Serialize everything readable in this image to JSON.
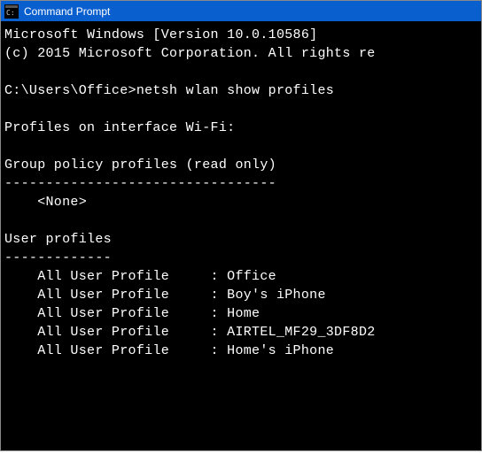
{
  "titlebar": {
    "title": "Command Prompt"
  },
  "console": {
    "banner_line1": "Microsoft Windows [Version 10.0.10586]",
    "banner_line2": "(c) 2015 Microsoft Corporation. All rights re",
    "prompt": "C:\\Users\\Office>",
    "command": "netsh wlan show profiles",
    "interface_line": "Profiles on interface Wi-Fi:",
    "group_header": "Group policy profiles (read only)",
    "group_dashes": "---------------------------------",
    "group_none": "    <None>",
    "user_header": "User profiles",
    "user_dashes": "-------------",
    "profiles": [
      {
        "label": "    All User Profile     : ",
        "name": "Office"
      },
      {
        "label": "    All User Profile     : ",
        "name": "Boy's iPhone"
      },
      {
        "label": "    All User Profile     : ",
        "name": "Home"
      },
      {
        "label": "    All User Profile     : ",
        "name": "AIRTEL_MF29_3DF8D2"
      },
      {
        "label": "    All User Profile     : ",
        "name": "Home's iPhone"
      }
    ]
  }
}
